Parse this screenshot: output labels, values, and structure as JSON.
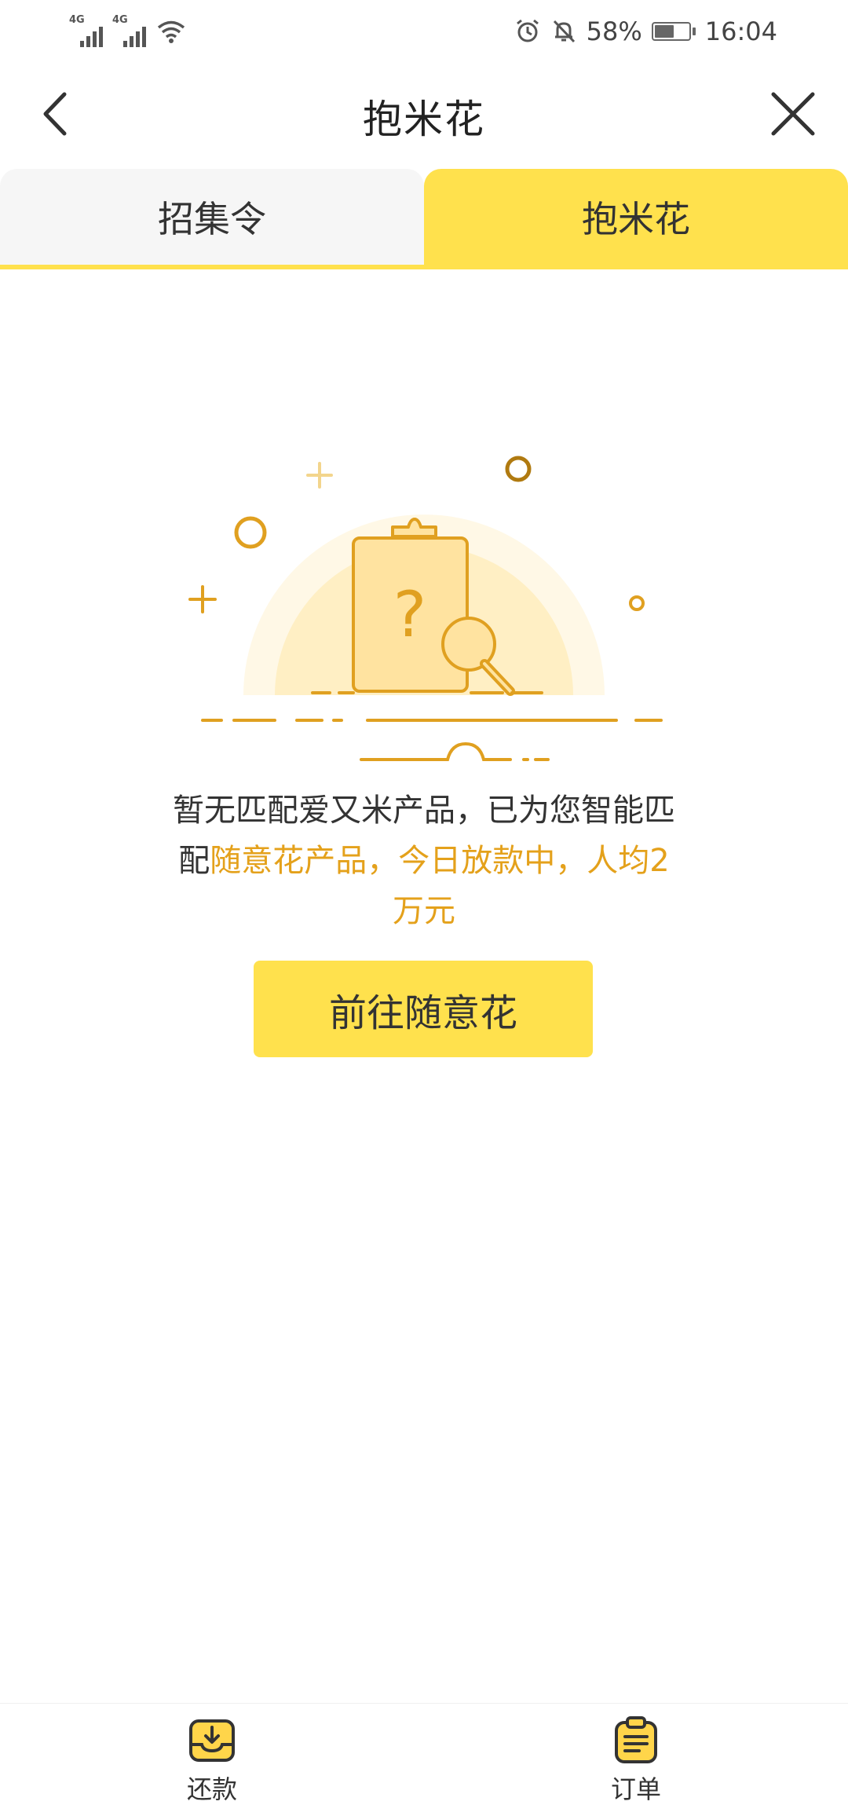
{
  "status_bar": {
    "network_1": "4G",
    "network_2": "4G",
    "battery_percent": "58%",
    "time": "16:04"
  },
  "title_bar": {
    "title": "抱米花"
  },
  "tabs": [
    {
      "label": "招集令",
      "active": false
    },
    {
      "label": "抱米花",
      "active": true
    }
  ],
  "empty_state": {
    "message_part1": "暂无匹配爱又米产品，已为您智能匹配",
    "message_highlight": "随意花产品，今日放款中，人均2万元",
    "button_label": "前往随意花"
  },
  "bottom_nav": [
    {
      "label": "还款",
      "icon": "download-tray-icon"
    },
    {
      "label": "订单",
      "icon": "clipboard-list-icon"
    }
  ],
  "colors": {
    "accent_yellow": "#ffe14d",
    "highlight_orange": "#e4a11b",
    "illustration_gold": "#e0a020"
  }
}
